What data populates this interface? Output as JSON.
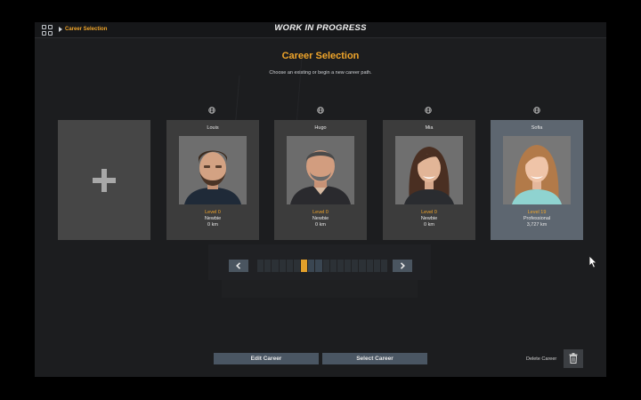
{
  "header": {
    "breadcrumb": "Career Selection",
    "banner": "WORK IN PROGRESS"
  },
  "page": {
    "title": "Career Selection",
    "subtitle": "Choose an existing or begin a new career path."
  },
  "careers": [
    {
      "name": "Louis",
      "level": "Level 0",
      "rank": "Newbie",
      "distance": "0 km",
      "selected": false
    },
    {
      "name": "Hugo",
      "level": "Level 0",
      "rank": "Newbie",
      "distance": "0 km",
      "selected": false
    },
    {
      "name": "Mia",
      "level": "Level 0",
      "rank": "Newbie",
      "distance": "0 km",
      "selected": false
    },
    {
      "name": "Sofia",
      "level": "Level 19",
      "rank": "Professional",
      "distance": "3,727 km",
      "selected": true
    }
  ],
  "pager": {
    "segment_count": 18,
    "active_index": 6,
    "filled_indices": [
      7,
      8
    ]
  },
  "actions": {
    "edit": "Edit Career",
    "select": "Select Career",
    "delete": "Delete Career"
  },
  "icons": {
    "menu": "grid-icon",
    "breadcrumb": "chevron-right-icon",
    "online": "globe-icon",
    "new": "plus-icon",
    "prev": "chevron-left-icon",
    "next": "chevron-right-icon",
    "delete": "trash-icon"
  },
  "colors": {
    "accent": "#f0a52a",
    "card": "#3c3c3c",
    "card_selected": "#5d6670",
    "button": "#4a5663",
    "background": "#1c1d1f"
  }
}
